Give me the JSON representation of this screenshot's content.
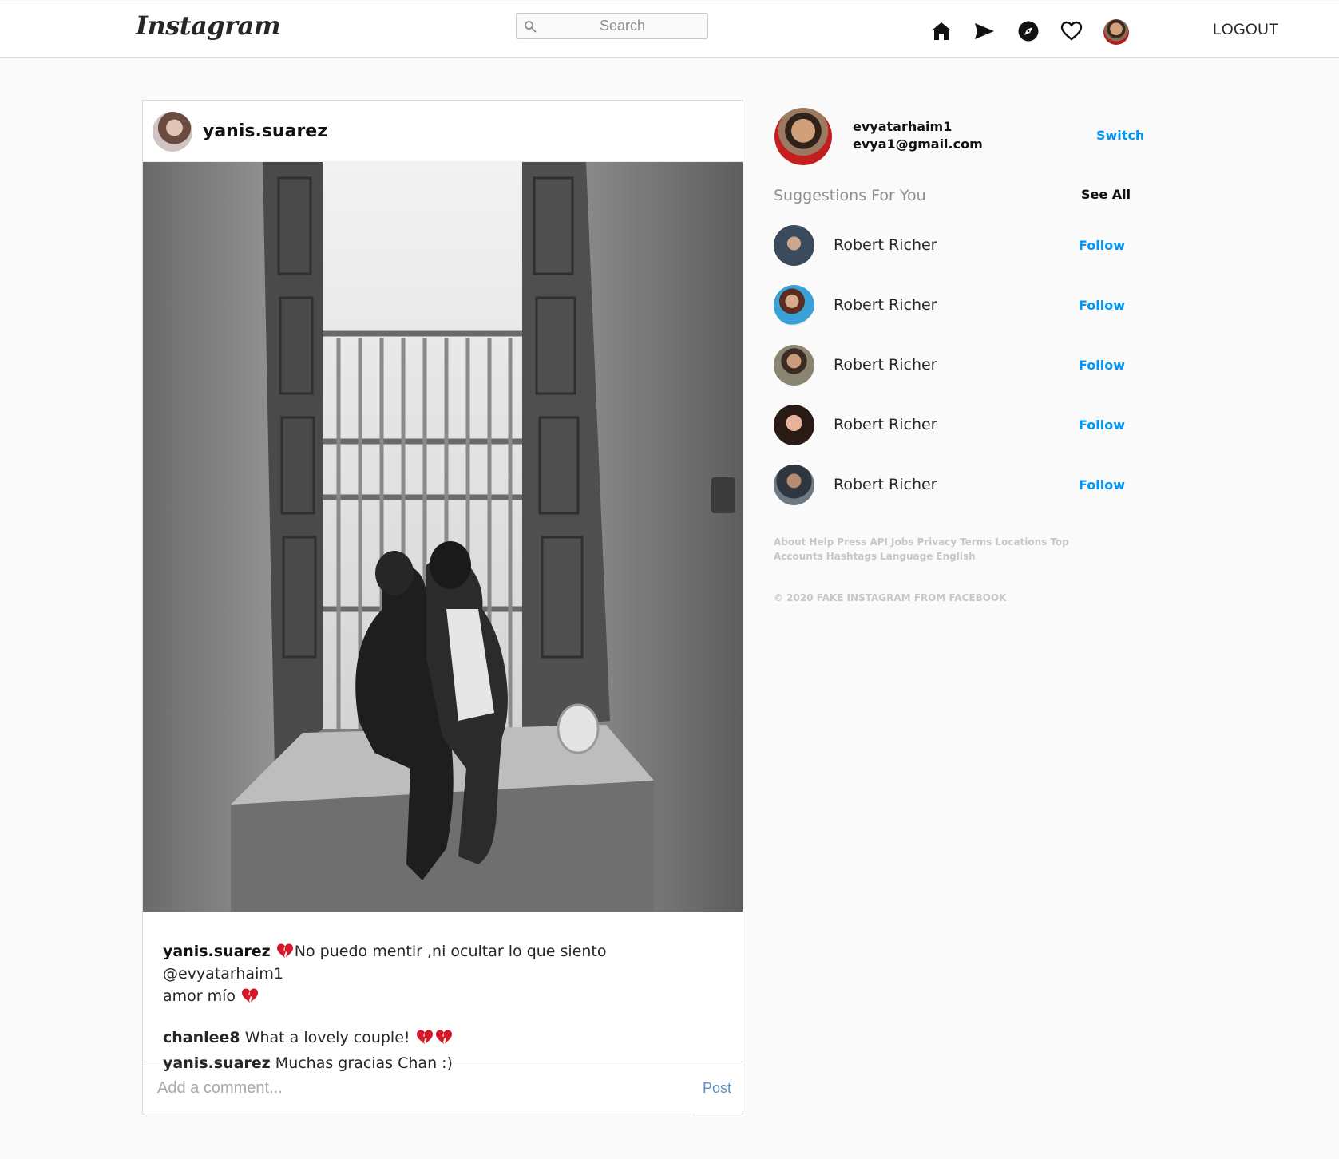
{
  "header": {
    "logo": "Instagram",
    "search_placeholder": "Search",
    "logout_label": "LOGOUT",
    "icons": [
      "home-icon",
      "send-icon",
      "explore-icon",
      "heart-icon",
      "profile-avatar"
    ]
  },
  "post": {
    "username": "yanis.suarez",
    "image_description_icon": "photo",
    "caption": {
      "user": "yanis.suarez",
      "text_part1": "No puedo mentir ,ni ocultar lo que siento @evyatarhaim1",
      "text_part2": "amor mío"
    },
    "comments": [
      {
        "user": "chanlee8",
        "text": "What a lovely couple!"
      },
      {
        "user": "yanis.suarez",
        "text": "Muchas gracias Chan :)"
      }
    ],
    "comment_placeholder": "Add a comment...",
    "post_label": "Post"
  },
  "sidebar": {
    "username": "evyatarhaim1",
    "email": "evya1@gmail.com",
    "switch_label": "Switch",
    "suggestions_title": "Suggestions For You",
    "see_all_label": "See All",
    "suggestions": [
      {
        "name": "Robert Richer",
        "follow_label": "Follow"
      },
      {
        "name": "Robert Richer",
        "follow_label": "Follow"
      },
      {
        "name": "Robert Richer",
        "follow_label": "Follow"
      },
      {
        "name": "Robert Richer",
        "follow_label": "Follow"
      },
      {
        "name": "Robert Richer",
        "follow_label": "Follow"
      }
    ],
    "footer_links": [
      "About",
      "Help",
      "Press",
      "API",
      "Jobs",
      "Privacy",
      "Terms",
      "Locations",
      "Top Accounts",
      "Hashtags",
      "Language",
      "English"
    ],
    "copyright": "© 2020 FAKE INSTAGRAM FROM FACEBOOK"
  },
  "colors": {
    "link_blue": "#0095f6",
    "post_button": "#5b8fc2",
    "heart_red": "#d6192a"
  }
}
